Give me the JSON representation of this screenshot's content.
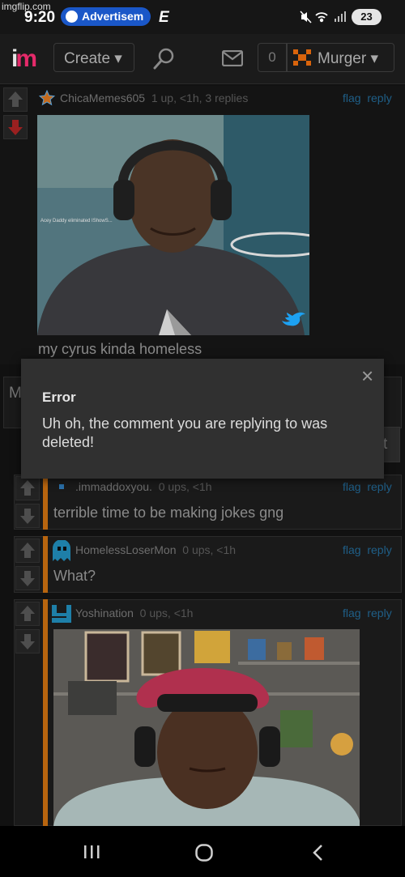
{
  "watermark": "imgflip.com",
  "status_bar": {
    "time": "9:20",
    "spotify_label": "Advertisem",
    "espn_label": "E",
    "battery": "23"
  },
  "header": {
    "logo_i": "i",
    "logo_m": "m",
    "create_label": "Create ▾",
    "notifications": "0",
    "username": "Murger ▾"
  },
  "comments": [
    {
      "user": "ChicaMemes605",
      "meta": "1 up, <1h, 3 replies",
      "flag": "flag",
      "reply": "reply",
      "text": "my cyrus kinda homeless",
      "image_caption": "Acey Daddy eliminated IShowS..."
    },
    {
      "user": ".immaddoxyou.",
      "meta": "0 ups, <1h",
      "flag": "flag",
      "reply": "reply",
      "text": "terrible time to be making jokes gng"
    },
    {
      "user": "HomelessLoserMon",
      "meta": "0 ups, <1h",
      "flag": "flag",
      "reply": "reply",
      "text": "What?"
    },
    {
      "user": "Yoshination",
      "meta": "0 ups, <1h",
      "flag": "flag",
      "reply": "reply"
    }
  ],
  "behind": {
    "left_char": "M",
    "right_char": "t"
  },
  "modal": {
    "title": "Error",
    "message": "Uh oh, the comment you are replying to was deleted!",
    "close": "×"
  },
  "nav": {
    "recents": "|||",
    "home": "○",
    "back": "<"
  },
  "colors": {
    "accent_pink": "#e52a6a",
    "link_blue": "#1f5f88",
    "reply_bar": "#b8650f",
    "spotify_blue": "#1a57c8"
  }
}
